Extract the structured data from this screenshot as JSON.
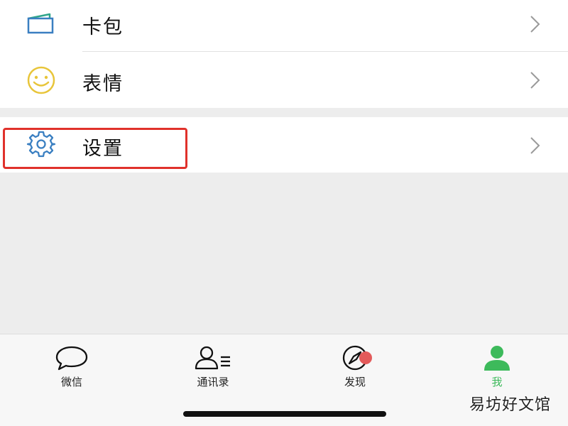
{
  "menu": {
    "items": [
      {
        "label": "卡包",
        "icon": "card-pack-icon"
      },
      {
        "label": "表情",
        "icon": "smiley-icon"
      },
      {
        "label": "设置",
        "icon": "gear-icon"
      }
    ]
  },
  "tabbar": {
    "tabs": [
      {
        "label": "微信",
        "icon": "chat-bubble-icon"
      },
      {
        "label": "通讯录",
        "icon": "contacts-icon"
      },
      {
        "label": "发现",
        "icon": "compass-icon",
        "badge": true
      },
      {
        "label": "我",
        "icon": "person-icon",
        "active": true
      }
    ]
  },
  "watermark": "易坊好文馆",
  "colors": {
    "accent_green": "#3dba5b",
    "highlight_red": "#e0312b",
    "badge_red": "#e35b5b",
    "icon_blue": "#3a7fc1",
    "smiley_yellow": "#e8c53a"
  }
}
